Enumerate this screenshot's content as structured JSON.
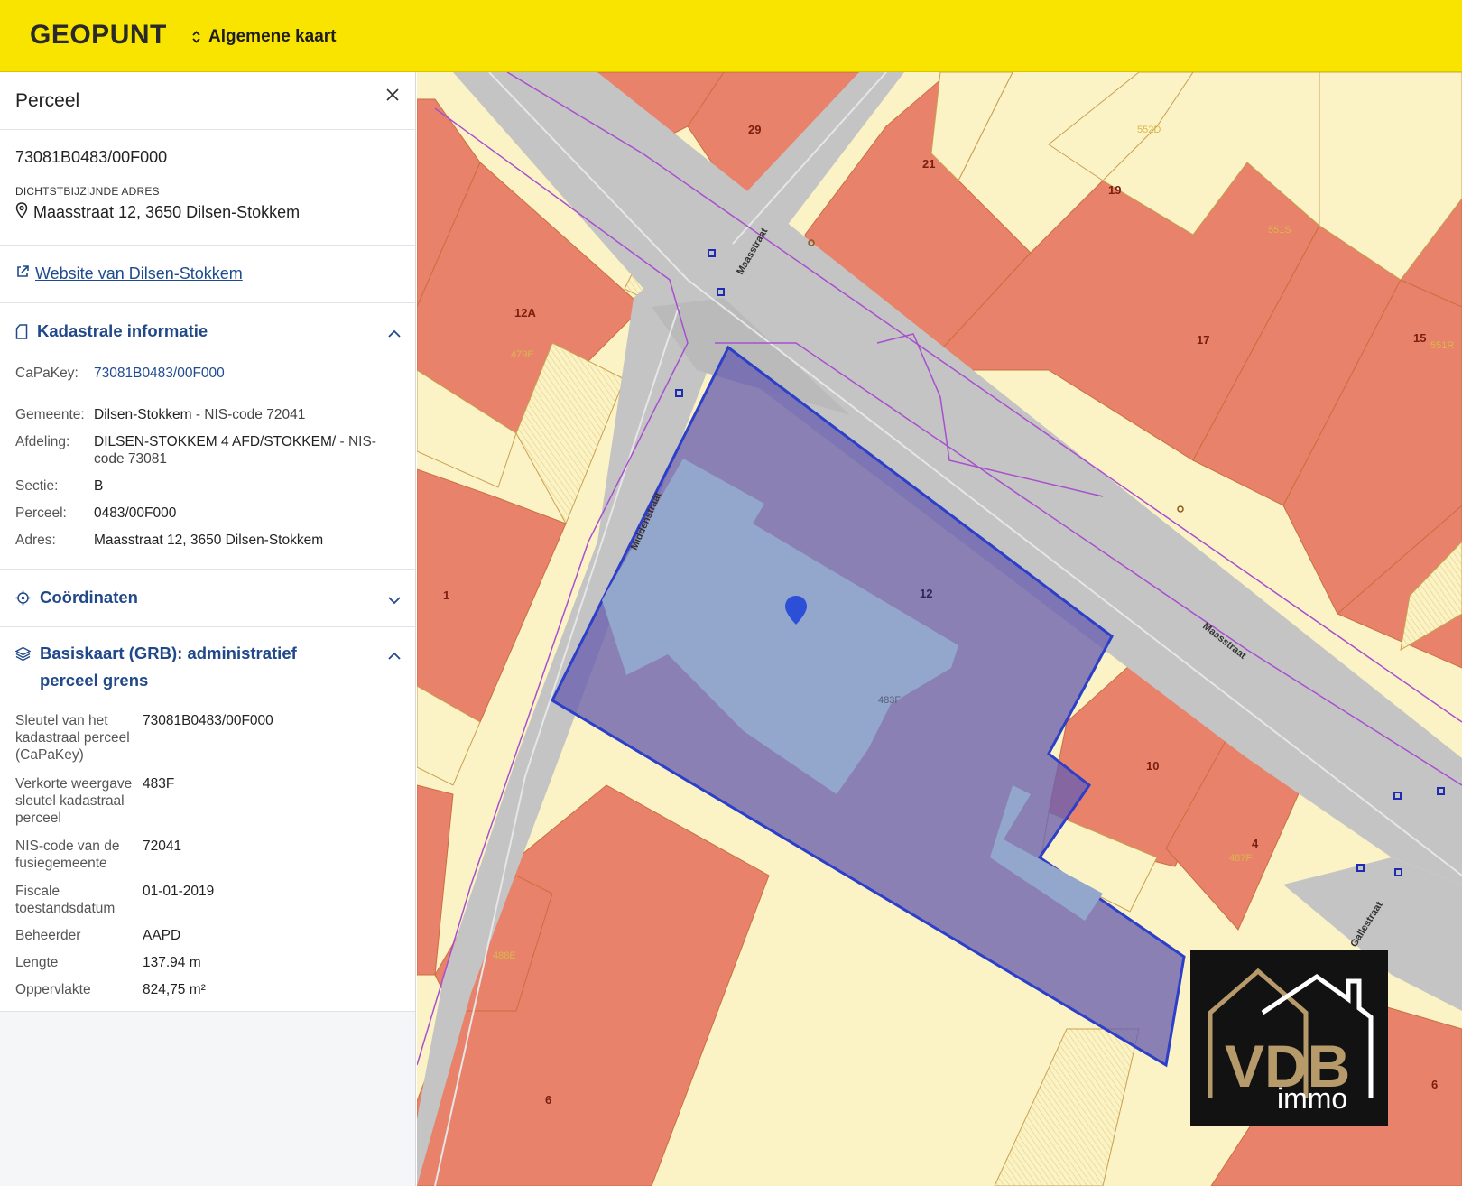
{
  "header": {
    "brand": "GEOPUNT",
    "map_selector": "Algemene kaart"
  },
  "panel": {
    "title": "Perceel",
    "parcel_id": "73081B0483/00F000",
    "address_label": "DICHTSTBIJZIJNDE ADRES",
    "address": "Maasstraat 12, 3650 Dilsen-Stokkem",
    "website_link": "Website van Dilsen-Stokkem",
    "kadastraal": {
      "title": "Kadastrale informatie",
      "capakey_label": "CaPaKey:",
      "capakey": "73081B0483/00F000",
      "gemeente_label": "Gemeente:",
      "gemeente": "Dilsen-Stokkem",
      "gemeente_nis": " - NIS-code 72041",
      "afdeling_label": "Afdeling:",
      "afdeling": "DILSEN-STOKKEM 4 AFD/STOKKEM/",
      "afdeling_nis": " - NIS-code 73081",
      "sectie_label": "Sectie:",
      "sectie": "B",
      "perceel_label": "Perceel:",
      "perceel": "0483/00F000",
      "adres_label": "Adres:",
      "adres": "Maasstraat 12, 3650 Dilsen-Stokkem"
    },
    "coordinaten": {
      "title": "Coördinaten"
    },
    "grb": {
      "title": "Basiskaart (GRB): administratief perceel grens",
      "rows": [
        {
          "label": "Sleutel van het kadastraal perceel (CaPaKey)",
          "value": "73081B0483/00F000"
        },
        {
          "label": "Verkorte weergave sleutel kadastraal perceel",
          "value": "483F"
        },
        {
          "label": "NIS-code van de fusiegemeente",
          "value": "72041"
        },
        {
          "label": "Fiscale toestandsdatum",
          "value": "01-01-2019"
        },
        {
          "label": "Beheerder",
          "value": "AAPD"
        },
        {
          "label": "Lengte",
          "value": "137.94 m"
        },
        {
          "label": "Oppervlakte",
          "value": "824,75 m²"
        }
      ]
    }
  },
  "map": {
    "colors": {
      "building": "#e8826a",
      "parcel": "#fbf3c5",
      "road": "#c4c4c4",
      "selected": "#6a5fb0",
      "selected_building": "#93a6cb",
      "outline": "#2c3fc9",
      "road_edge": "#a84fd0"
    },
    "streets": [
      "Maasstraat",
      "Maasstraat",
      "Middenstraat",
      "Gallestraat"
    ],
    "house_numbers": [
      "29",
      "21",
      "19",
      "17",
      "15",
      "12A",
      "12",
      "1",
      "10",
      "4",
      "6",
      "6"
    ],
    "parcel_codes": [
      "552D",
      "551S",
      "551R",
      "479E",
      "483F",
      "487F",
      "488E"
    ]
  },
  "logo": {
    "brand": "VDB",
    "sub": "immo"
  }
}
